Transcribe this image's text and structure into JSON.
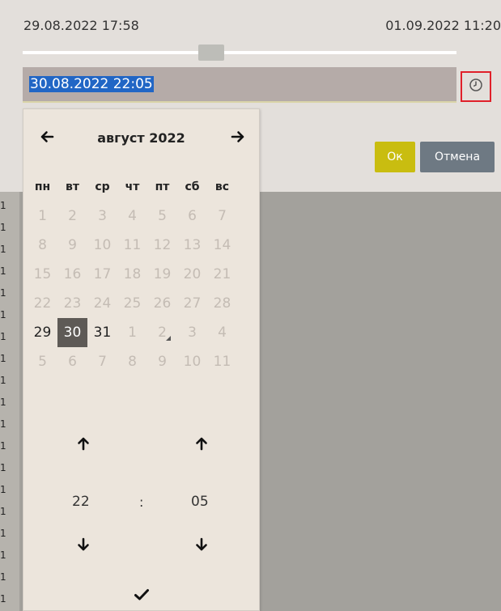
{
  "range": {
    "start": "29.08.2022 17:58",
    "end": "01.09.2022 11:20"
  },
  "slider": {
    "value": 0.44
  },
  "datetime_input": {
    "value": "30.08.2022 22:05"
  },
  "buttons": {
    "ok": "Ок",
    "cancel": "Отмена"
  },
  "calendar": {
    "month_title": "август 2022",
    "weekdays": [
      "пн",
      "вт",
      "ср",
      "чт",
      "пт",
      "сб",
      "вс"
    ],
    "weeks": [
      [
        {
          "d": "1",
          "m": true
        },
        {
          "d": "2",
          "m": true
        },
        {
          "d": "3",
          "m": true
        },
        {
          "d": "4",
          "m": true
        },
        {
          "d": "5",
          "m": true
        },
        {
          "d": "6",
          "m": true
        },
        {
          "d": "7",
          "m": true
        }
      ],
      [
        {
          "d": "8",
          "m": true
        },
        {
          "d": "9",
          "m": true
        },
        {
          "d": "10",
          "m": true
        },
        {
          "d": "11",
          "m": true
        },
        {
          "d": "12",
          "m": true
        },
        {
          "d": "13",
          "m": true
        },
        {
          "d": "14",
          "m": true
        }
      ],
      [
        {
          "d": "15",
          "m": true
        },
        {
          "d": "16",
          "m": true
        },
        {
          "d": "17",
          "m": true
        },
        {
          "d": "18",
          "m": true
        },
        {
          "d": "19",
          "m": true
        },
        {
          "d": "20",
          "m": true
        },
        {
          "d": "21",
          "m": true
        }
      ],
      [
        {
          "d": "22",
          "m": true
        },
        {
          "d": "23",
          "m": true
        },
        {
          "d": "24",
          "m": true
        },
        {
          "d": "25",
          "m": true
        },
        {
          "d": "26",
          "m": true
        },
        {
          "d": "27",
          "m": true
        },
        {
          "d": "28",
          "m": true
        }
      ],
      [
        {
          "d": "29",
          "m": false
        },
        {
          "d": "30",
          "m": false,
          "sel": true
        },
        {
          "d": "31",
          "m": false
        },
        {
          "d": "1",
          "m": true
        },
        {
          "d": "2",
          "m": true,
          "mark": true
        },
        {
          "d": "3",
          "m": true
        },
        {
          "d": "4",
          "m": true
        }
      ],
      [
        {
          "d": "5",
          "m": true
        },
        {
          "d": "6",
          "m": true
        },
        {
          "d": "7",
          "m": true
        },
        {
          "d": "8",
          "m": true
        },
        {
          "d": "9",
          "m": true
        },
        {
          "d": "10",
          "m": true
        },
        {
          "d": "11",
          "m": true
        }
      ]
    ]
  },
  "time": {
    "hour": "22",
    "separator": ":",
    "minute": "05"
  },
  "background_rows": {
    "label": "1",
    "count": 19
  },
  "icons": {
    "prev": "arrow-left-icon",
    "next": "arrow-right-icon",
    "up": "arrow-up-icon",
    "down": "arrow-down-icon",
    "clock": "clock-icon",
    "confirm": "checkmark-icon"
  },
  "colors": {
    "selection": "#2166c5",
    "selected_day": "#5e5a56",
    "ok_button": "#c9bd10",
    "cancel_button": "#6e7983",
    "clock_outline": "#e0202a"
  }
}
